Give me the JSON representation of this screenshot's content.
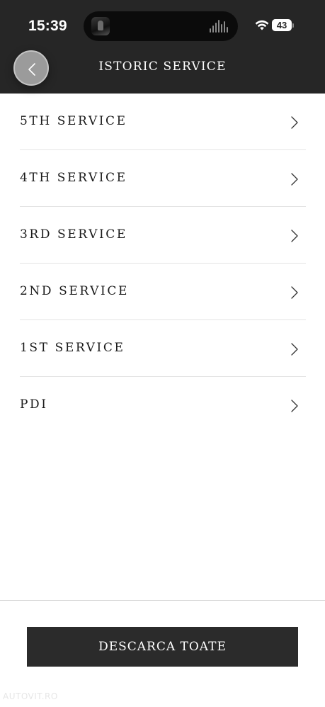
{
  "status_bar": {
    "time": "15:39",
    "battery_level": "43",
    "battery_fraction": 0.43
  },
  "header": {
    "title": "ISTORIC SERVICE",
    "back_icon": "chevron-left-icon"
  },
  "services": {
    "items": [
      {
        "label": "5TH SERVICE"
      },
      {
        "label": "4TH SERVICE"
      },
      {
        "label": "3RD SERVICE"
      },
      {
        "label": "2ND SERVICE"
      },
      {
        "label": "1ST SERVICE"
      },
      {
        "label": "PDI"
      }
    ],
    "row_icon": "chevron-right-icon"
  },
  "footer": {
    "download_all_label": "DESCARCA TOATE"
  },
  "watermark": {
    "text": "AUTOVIT.RO"
  },
  "colors": {
    "header_bg": "#262626",
    "button_bg": "#2b2b2b",
    "text": "#1a1a1a",
    "divider": "#e4e4e4"
  }
}
